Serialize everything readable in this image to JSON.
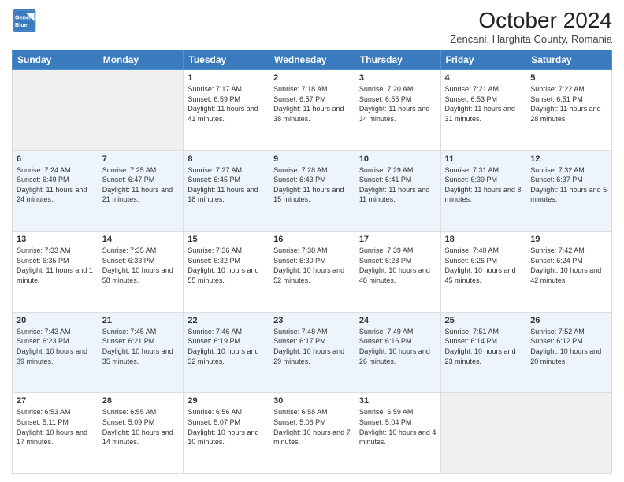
{
  "header": {
    "logo_line1": "General",
    "logo_line2": "Blue",
    "month_title": "October 2024",
    "location": "Zencani, Harghita County, Romania"
  },
  "days_of_week": [
    "Sunday",
    "Monday",
    "Tuesday",
    "Wednesday",
    "Thursday",
    "Friday",
    "Saturday"
  ],
  "weeks": [
    [
      {
        "day": "",
        "empty": true
      },
      {
        "day": "",
        "empty": true
      },
      {
        "day": "1",
        "sunrise": "7:17 AM",
        "sunset": "6:59 PM",
        "daylight": "11 hours and 41 minutes."
      },
      {
        "day": "2",
        "sunrise": "7:18 AM",
        "sunset": "6:57 PM",
        "daylight": "11 hours and 38 minutes."
      },
      {
        "day": "3",
        "sunrise": "7:20 AM",
        "sunset": "6:55 PM",
        "daylight": "11 hours and 34 minutes."
      },
      {
        "day": "4",
        "sunrise": "7:21 AM",
        "sunset": "6:53 PM",
        "daylight": "11 hours and 31 minutes."
      },
      {
        "day": "5",
        "sunrise": "7:22 AM",
        "sunset": "6:51 PM",
        "daylight": "11 hours and 28 minutes."
      }
    ],
    [
      {
        "day": "6",
        "sunrise": "7:24 AM",
        "sunset": "6:49 PM",
        "daylight": "11 hours and 24 minutes."
      },
      {
        "day": "7",
        "sunrise": "7:25 AM",
        "sunset": "6:47 PM",
        "daylight": "11 hours and 21 minutes."
      },
      {
        "day": "8",
        "sunrise": "7:27 AM",
        "sunset": "6:45 PM",
        "daylight": "11 hours and 18 minutes."
      },
      {
        "day": "9",
        "sunrise": "7:28 AM",
        "sunset": "6:43 PM",
        "daylight": "11 hours and 15 minutes."
      },
      {
        "day": "10",
        "sunrise": "7:29 AM",
        "sunset": "6:41 PM",
        "daylight": "11 hours and 11 minutes."
      },
      {
        "day": "11",
        "sunrise": "7:31 AM",
        "sunset": "6:39 PM",
        "daylight": "11 hours and 8 minutes."
      },
      {
        "day": "12",
        "sunrise": "7:32 AM",
        "sunset": "6:37 PM",
        "daylight": "11 hours and 5 minutes."
      }
    ],
    [
      {
        "day": "13",
        "sunrise": "7:33 AM",
        "sunset": "6:35 PM",
        "daylight": "11 hours and 1 minute."
      },
      {
        "day": "14",
        "sunrise": "7:35 AM",
        "sunset": "6:33 PM",
        "daylight": "10 hours and 58 minutes."
      },
      {
        "day": "15",
        "sunrise": "7:36 AM",
        "sunset": "6:32 PM",
        "daylight": "10 hours and 55 minutes."
      },
      {
        "day": "16",
        "sunrise": "7:38 AM",
        "sunset": "6:30 PM",
        "daylight": "10 hours and 52 minutes."
      },
      {
        "day": "17",
        "sunrise": "7:39 AM",
        "sunset": "6:28 PM",
        "daylight": "10 hours and 48 minutes."
      },
      {
        "day": "18",
        "sunrise": "7:40 AM",
        "sunset": "6:26 PM",
        "daylight": "10 hours and 45 minutes."
      },
      {
        "day": "19",
        "sunrise": "7:42 AM",
        "sunset": "6:24 PM",
        "daylight": "10 hours and 42 minutes."
      }
    ],
    [
      {
        "day": "20",
        "sunrise": "7:43 AM",
        "sunset": "6:23 PM",
        "daylight": "10 hours and 39 minutes."
      },
      {
        "day": "21",
        "sunrise": "7:45 AM",
        "sunset": "6:21 PM",
        "daylight": "10 hours and 35 minutes."
      },
      {
        "day": "22",
        "sunrise": "7:46 AM",
        "sunset": "6:19 PM",
        "daylight": "10 hours and 32 minutes."
      },
      {
        "day": "23",
        "sunrise": "7:48 AM",
        "sunset": "6:17 PM",
        "daylight": "10 hours and 29 minutes."
      },
      {
        "day": "24",
        "sunrise": "7:49 AM",
        "sunset": "6:16 PM",
        "daylight": "10 hours and 26 minutes."
      },
      {
        "day": "25",
        "sunrise": "7:51 AM",
        "sunset": "6:14 PM",
        "daylight": "10 hours and 23 minutes."
      },
      {
        "day": "26",
        "sunrise": "7:52 AM",
        "sunset": "6:12 PM",
        "daylight": "10 hours and 20 minutes."
      }
    ],
    [
      {
        "day": "27",
        "sunrise": "6:53 AM",
        "sunset": "5:11 PM",
        "daylight": "10 hours and 17 minutes."
      },
      {
        "day": "28",
        "sunrise": "6:55 AM",
        "sunset": "5:09 PM",
        "daylight": "10 hours and 14 minutes."
      },
      {
        "day": "29",
        "sunrise": "6:56 AM",
        "sunset": "5:07 PM",
        "daylight": "10 hours and 10 minutes."
      },
      {
        "day": "30",
        "sunrise": "6:58 AM",
        "sunset": "5:06 PM",
        "daylight": "10 hours and 7 minutes."
      },
      {
        "day": "31",
        "sunrise": "6:59 AM",
        "sunset": "5:04 PM",
        "daylight": "10 hours and 4 minutes."
      },
      {
        "day": "",
        "empty": true
      },
      {
        "day": "",
        "empty": true
      }
    ]
  ]
}
